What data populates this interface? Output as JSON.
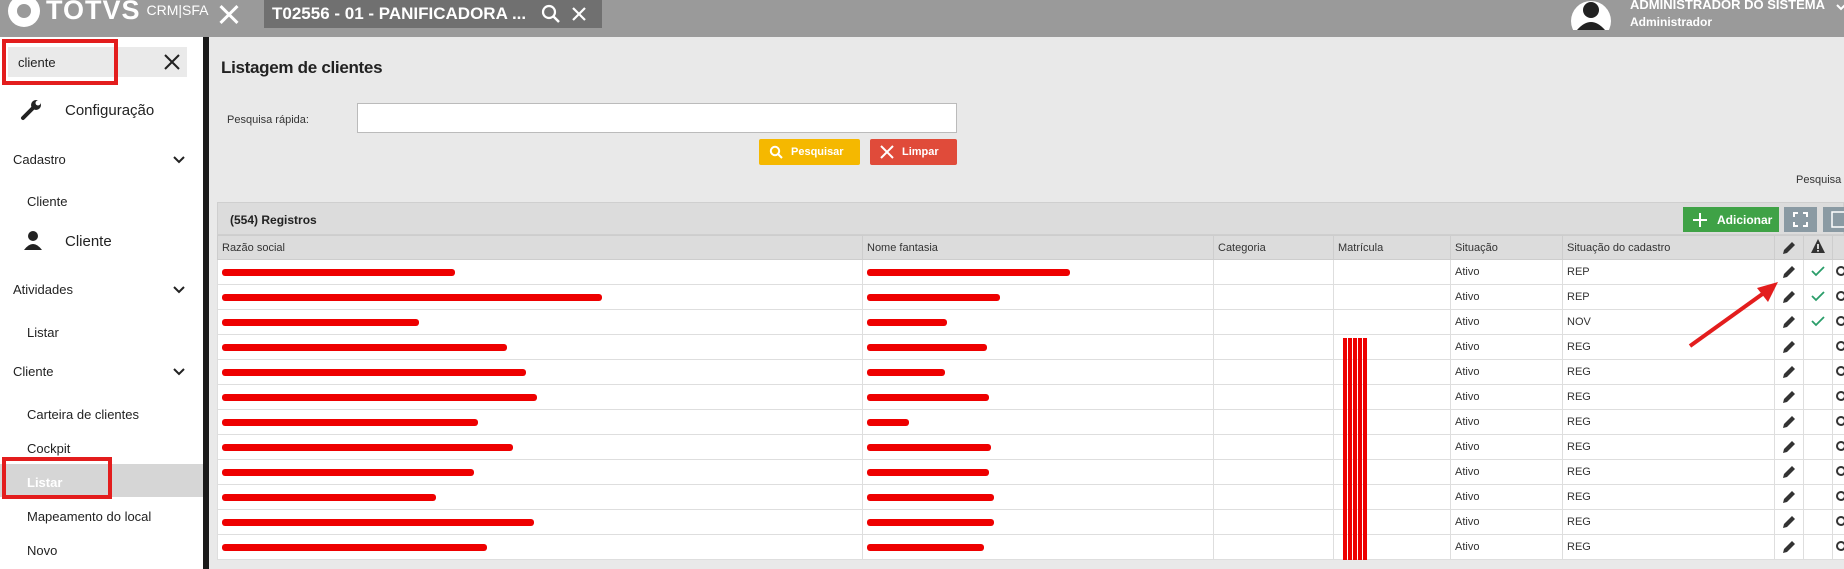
{
  "header": {
    "logo_text": "TOTVS",
    "logo_sub": "CRM|SFA",
    "tab_title": "T02556 - 01 - PANIFICADORA ...",
    "user_name": "ADMINISTRADOR DO SISTEMA",
    "user_role": "Administrador"
  },
  "sidebar": {
    "search_value": "cliente",
    "config_label": "Configuração",
    "sections": [
      {
        "title": "Cadastro",
        "items": [
          "Cliente"
        ]
      },
      {
        "title": "Atividades",
        "items": [
          "Listar"
        ]
      },
      {
        "title": "Cliente",
        "items": [
          "Carteira de clientes",
          "Cockpit",
          "Listar",
          "Mapeamento do local",
          "Novo"
        ]
      }
    ],
    "cliente_link": "Cliente",
    "active_item": "Listar"
  },
  "main": {
    "title": "Listagem de clientes",
    "quick_search_label": "Pesquisa rápida:",
    "search_button": "Pesquisar",
    "clear_button": "Limpar",
    "advanced_search": "Pesquisa avançada",
    "records": "(554) Registros",
    "add_button": "Adicionar",
    "columns": [
      "Razão social",
      "Nome fantasia",
      "Categoria",
      "Matrícula",
      "Situação",
      "Situação do cadastro"
    ],
    "rows": [
      {
        "situacao": "Ativo",
        "cadastro": "REP",
        "ok": true
      },
      {
        "situacao": "Ativo",
        "cadastro": "REP",
        "ok": true
      },
      {
        "situacao": "Ativo",
        "cadastro": "NOV",
        "ok": true
      },
      {
        "situacao": "Ativo",
        "cadastro": "REG",
        "ok": false
      },
      {
        "situacao": "Ativo",
        "cadastro": "REG",
        "ok": false
      },
      {
        "situacao": "Ativo",
        "cadastro": "REG",
        "ok": false
      },
      {
        "situacao": "Ativo",
        "cadastro": "REG",
        "ok": false
      },
      {
        "situacao": "Ativo",
        "cadastro": "REG",
        "ok": false
      },
      {
        "situacao": "Ativo",
        "cadastro": "REG",
        "ok": false
      },
      {
        "situacao": "Ativo",
        "cadastro": "REG",
        "ok": false
      },
      {
        "situacao": "Ativo",
        "cadastro": "REG",
        "ok": false
      },
      {
        "situacao": "Ativo",
        "cadastro": "REG",
        "ok": false
      }
    ]
  },
  "colors": {
    "accent": "#f5b800",
    "danger": "#e04b3a",
    "success": "#3fa246",
    "annotation": "#e31d1d"
  }
}
